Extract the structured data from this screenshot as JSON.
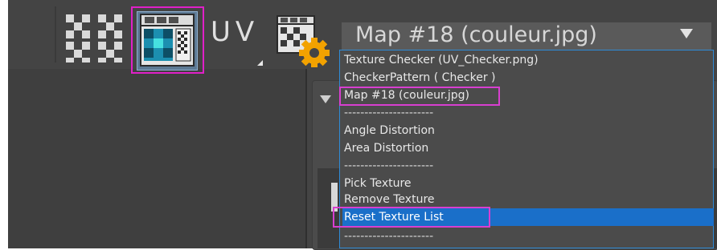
{
  "toolbar": {
    "uv_label": "UV",
    "map_select": {
      "value": "Map #18 (couleur.jpg)"
    }
  },
  "icons": {
    "checker": "checker-pattern-icon",
    "texture_view": "texture-window-icon",
    "texture_settings": "texture-gear-icon",
    "chevron": "chevron-down-icon"
  },
  "dropdown": {
    "items": [
      {
        "label": "Texture Checker (UV_Checker.png)"
      },
      {
        "label": "CheckerPattern  ( Checker )"
      },
      {
        "label": "Map #18 (couleur.jpg)",
        "highlighted": true
      },
      {
        "label": "----------------------"
      },
      {
        "label": "Angle Distortion"
      },
      {
        "label": "Area Distortion"
      },
      {
        "label": "----------------------"
      },
      {
        "label": "Pick Texture"
      },
      {
        "label": "Remove Texture"
      },
      {
        "label": "Reset Texture List",
        "selected": true,
        "highlighted": true
      },
      {
        "label": "----------------------"
      }
    ]
  },
  "colors": {
    "panel_bg": "#444444",
    "highlight_border": "#d83fd0",
    "selection_bg": "#1a6fc9",
    "dropdown_border": "#2f8bd6"
  }
}
